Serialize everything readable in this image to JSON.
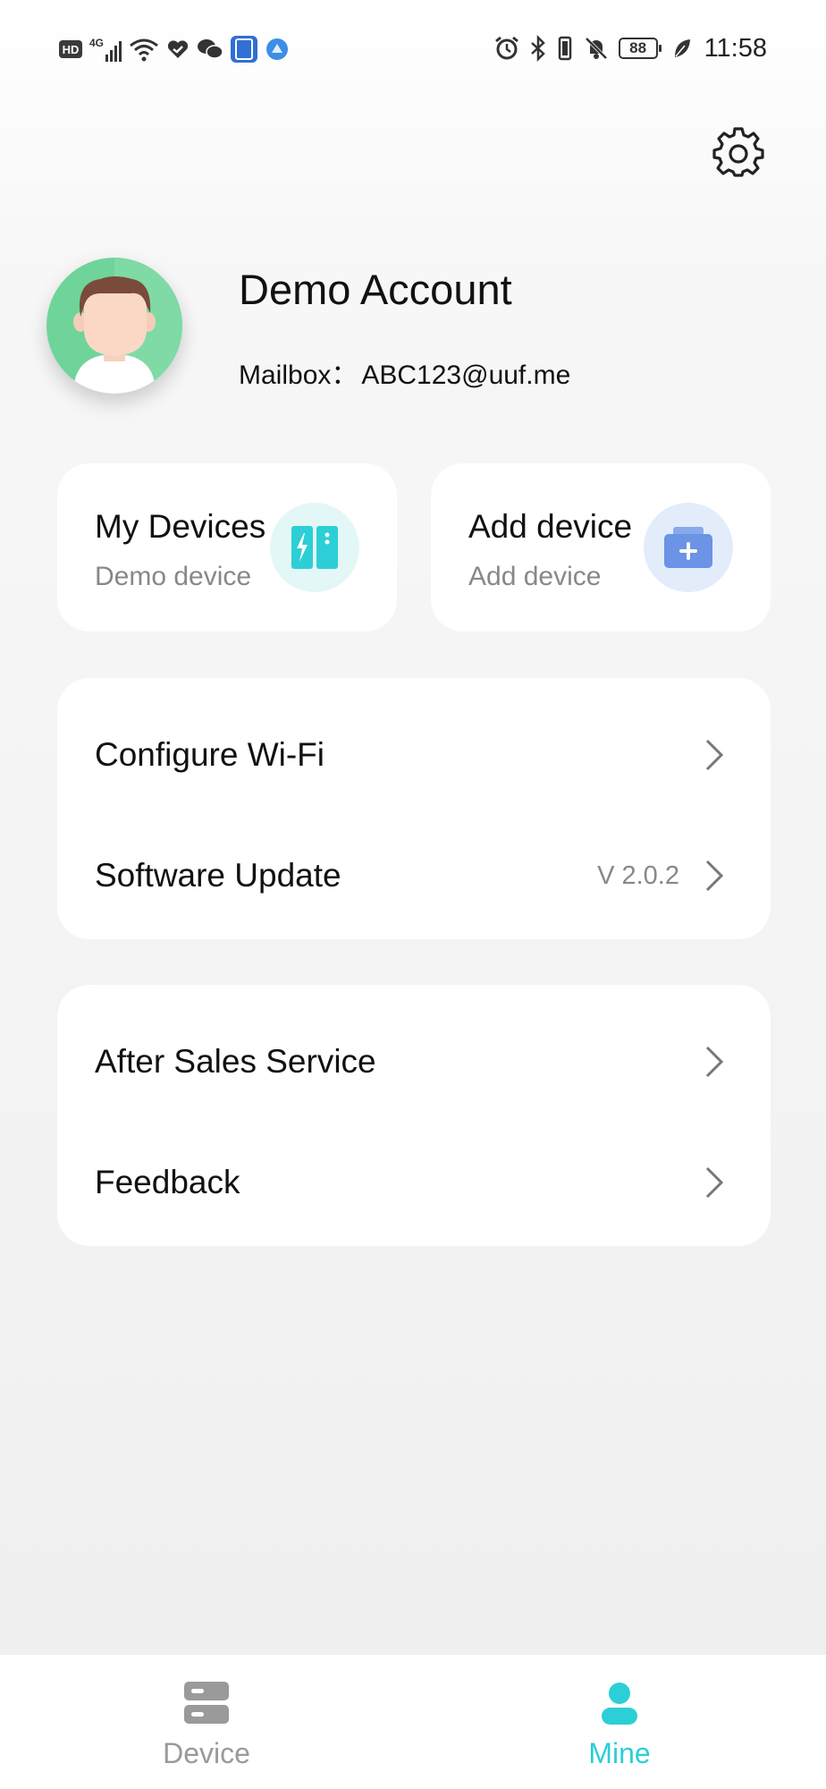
{
  "status_bar": {
    "left_icons": [
      "hd-icon",
      "signal-4g-icon",
      "wifi-icon",
      "heart-shield-icon",
      "wechat-icon",
      "app-badge-icon",
      "browser-icon"
    ],
    "signal_label": "4G",
    "hd_label": "HD",
    "right_icons": [
      "alarm-icon",
      "bluetooth-icon",
      "vibrate-icon",
      "mute-bell-icon",
      "battery-icon",
      "leaf-icon"
    ],
    "battery_level": "88",
    "time": "11:58"
  },
  "header": {
    "settings_icon": "gear-icon"
  },
  "profile": {
    "name": "Demo Account",
    "mail_label": "Mailbox：",
    "mail_value": "ABC123@uuf.me"
  },
  "quick_cards": [
    {
      "title": "My Devices",
      "subtitle": "Demo device",
      "icon": "charging-station-icon",
      "icon_bg": "#e3f7f7",
      "icon_color": "#2ccfd6"
    },
    {
      "title": "Add device",
      "subtitle": "Add device",
      "icon": "add-box-icon",
      "icon_bg": "#e3ecfb",
      "icon_color": "#6b93e6"
    }
  ],
  "menu_groups": [
    {
      "items": [
        {
          "label": "Configure Wi-Fi",
          "value": ""
        },
        {
          "label": "Software Update",
          "value": "V 2.0.2"
        }
      ]
    },
    {
      "items": [
        {
          "label": "After Sales Service",
          "value": ""
        },
        {
          "label": "Feedback",
          "value": ""
        }
      ]
    }
  ],
  "tab_bar": {
    "tabs": [
      {
        "label": "Device",
        "icon": "device-list-icon",
        "active": false
      },
      {
        "label": "Mine",
        "icon": "person-icon",
        "active": true
      }
    ],
    "active_color": "#2ccfd6",
    "inactive_color": "#9a9a9a"
  }
}
